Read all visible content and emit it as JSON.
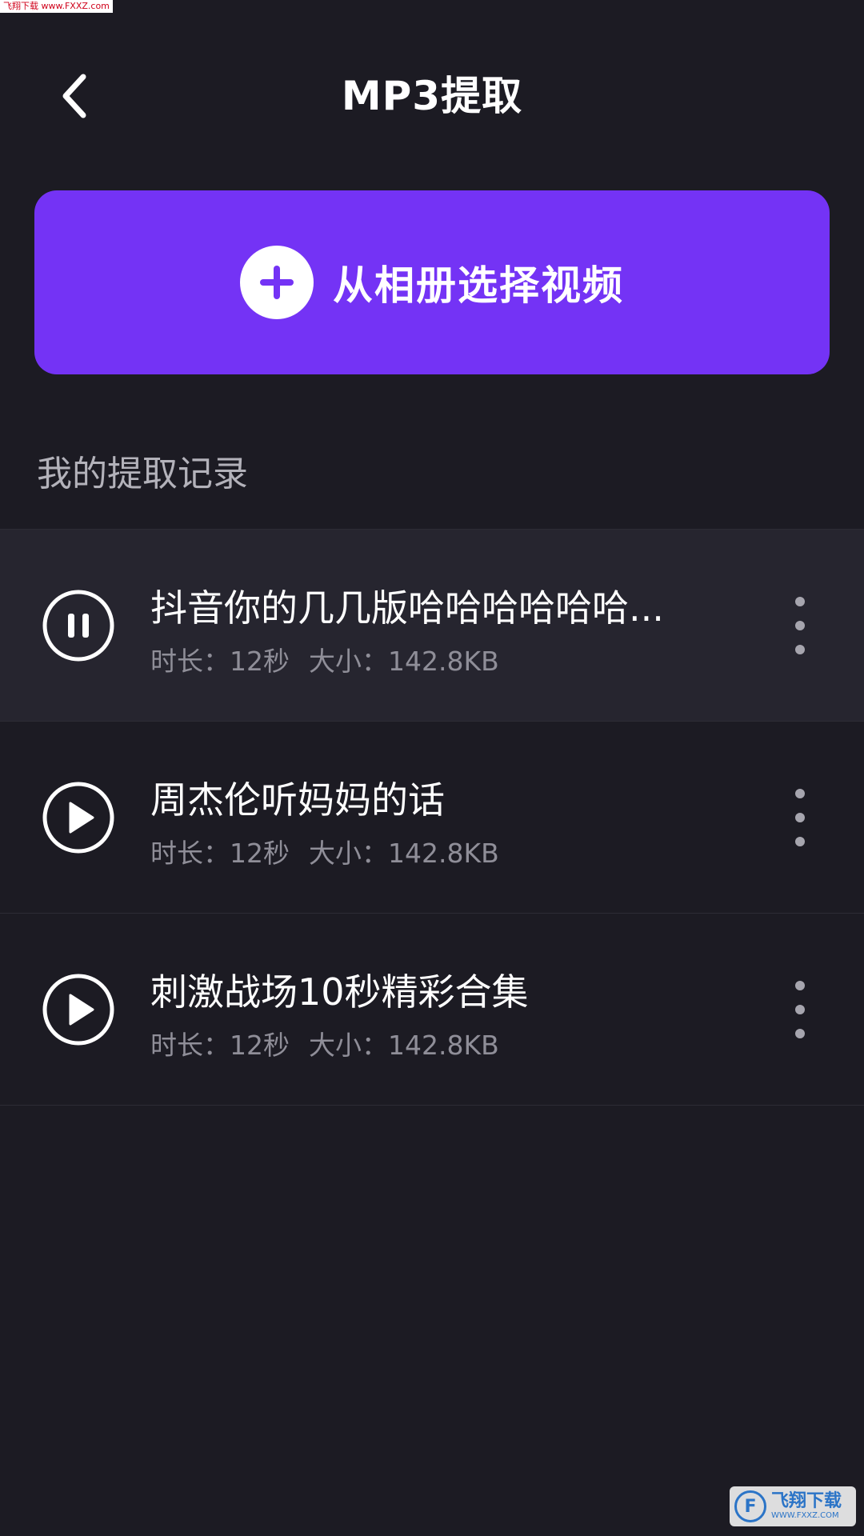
{
  "watermark_top": "飞翔下载 www.FXXZ.com",
  "header": {
    "title": "MP3提取",
    "back_icon": "chevron-left-icon"
  },
  "select_button": {
    "label": "从相册选择视频",
    "icon": "plus-icon"
  },
  "section": {
    "title": "我的提取记录"
  },
  "records": [
    {
      "title": "抖音你的几几版哈哈哈哈哈哈...",
      "duration": "时长：12秒",
      "size": "大小：142.8KB",
      "state": "playing",
      "icon": "pause-icon"
    },
    {
      "title": "周杰伦听妈妈的话",
      "duration": "时长：12秒",
      "size": "大小：142.8KB",
      "state": "stopped",
      "icon": "play-icon"
    },
    {
      "title": "刺激战场10秒精彩合集",
      "duration": "时长：12秒",
      "size": "大小：142.8KB",
      "state": "stopped",
      "icon": "play-icon"
    }
  ],
  "watermark_bottom": {
    "name": "飞翔下载",
    "url": "WWW.FXXZ.COM"
  },
  "colors": {
    "background": "#1c1b23",
    "accent": "#7433f5",
    "active_row": "#26252f",
    "muted_text": "#8f8e98"
  }
}
